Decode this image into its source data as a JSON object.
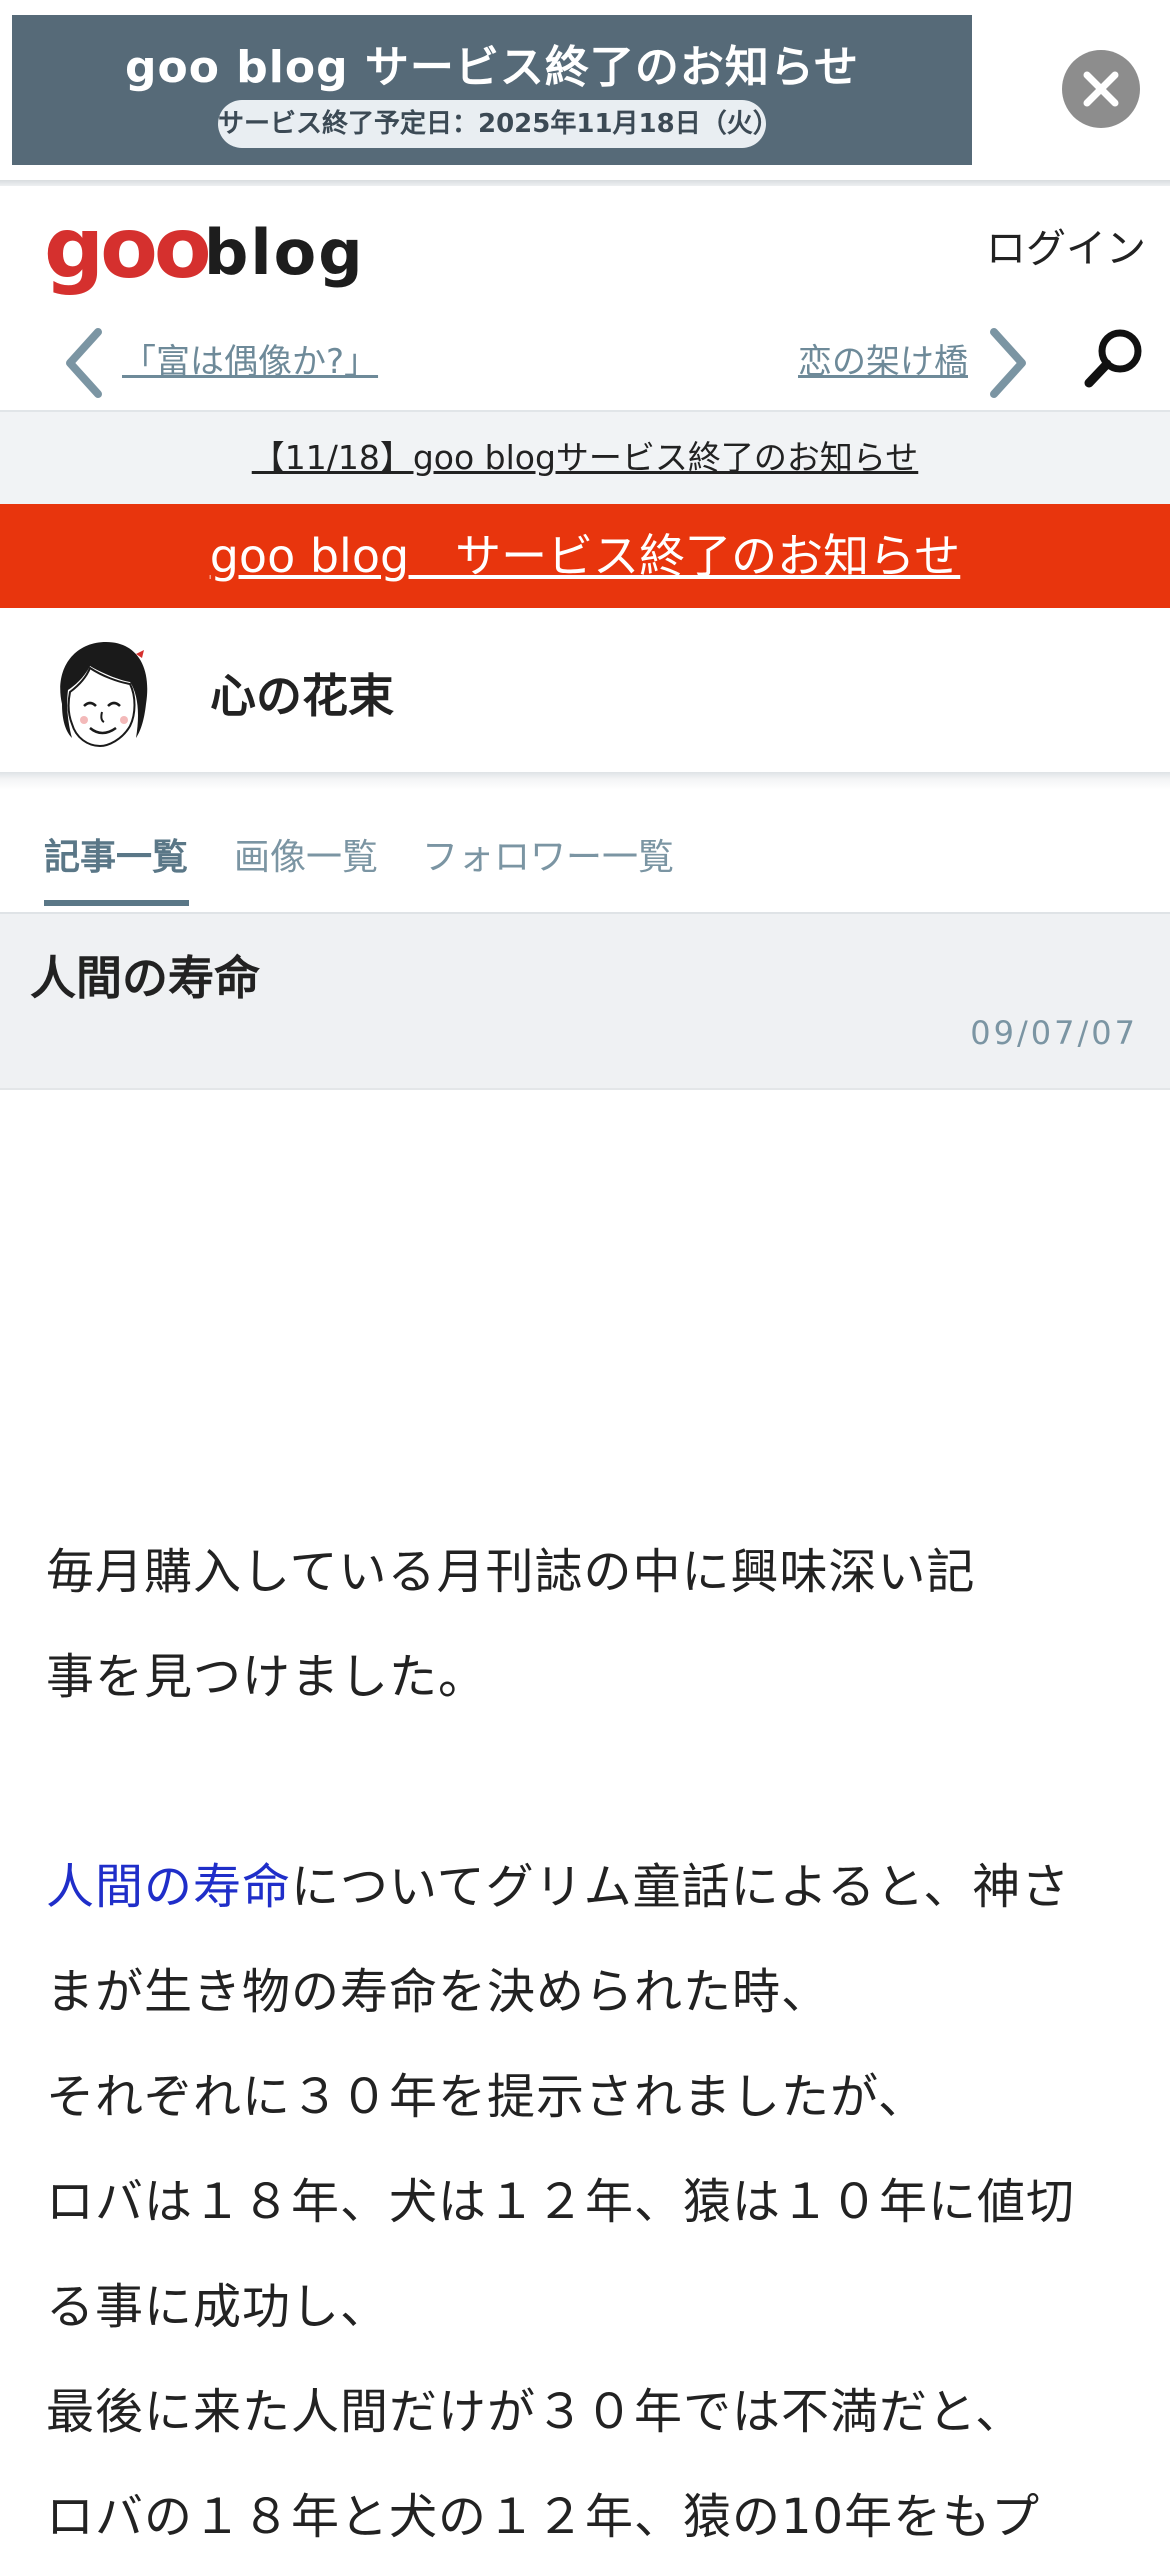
{
  "banner": {
    "title": "goo blog サービス終了のお知らせ",
    "subtitle": "サービス終了予定日：2025年11月18日（火）"
  },
  "header": {
    "logo_goo": "goo",
    "logo_blog": "blog",
    "login": "ログイン",
    "prev_title": "「富は偶像か?」",
    "next_title": "恋の架け橋"
  },
  "notice": {
    "text": "【11/18】goo blogサービス終了のお知らせ"
  },
  "announce": {
    "text": "goo blog　サービス終了のお知らせ"
  },
  "blog": {
    "name": "心の花束"
  },
  "tabs": [
    {
      "label": "記事一覧",
      "active": true
    },
    {
      "label": "画像一覧",
      "active": false
    },
    {
      "label": "フォロワー一覧",
      "active": false
    }
  ],
  "article": {
    "title": "人間の寿命",
    "date": "09/07/07",
    "p1_line1": "毎月購入している月刊誌の中に興味深い記",
    "p1_line2": "事を見つけました。",
    "p2_link": "人間の寿命",
    "p2_line1_rest": "についてグリム童話によると、神さ",
    "p2_line2": "まが生き物の寿命を決められた時、",
    "p2_line3": "それぞれに３０年を提示されましたが、",
    "p2_line4": "ロバは１８年、犬は１２年、猿は１０年に値切",
    "p2_line5": "る事に成功し、",
    "p2_line6": "最後に来た人間だけが３０年では不満だと、",
    "p2_line7": "ロバの１８年と犬の１２年、猿の10年をもプ"
  },
  "colors": {
    "banner_bg": "#566a78",
    "logo_red": "#d5302e",
    "announce_red": "#e8350d",
    "accent": "#5a7787",
    "link_blue": "#1f2ec9"
  }
}
